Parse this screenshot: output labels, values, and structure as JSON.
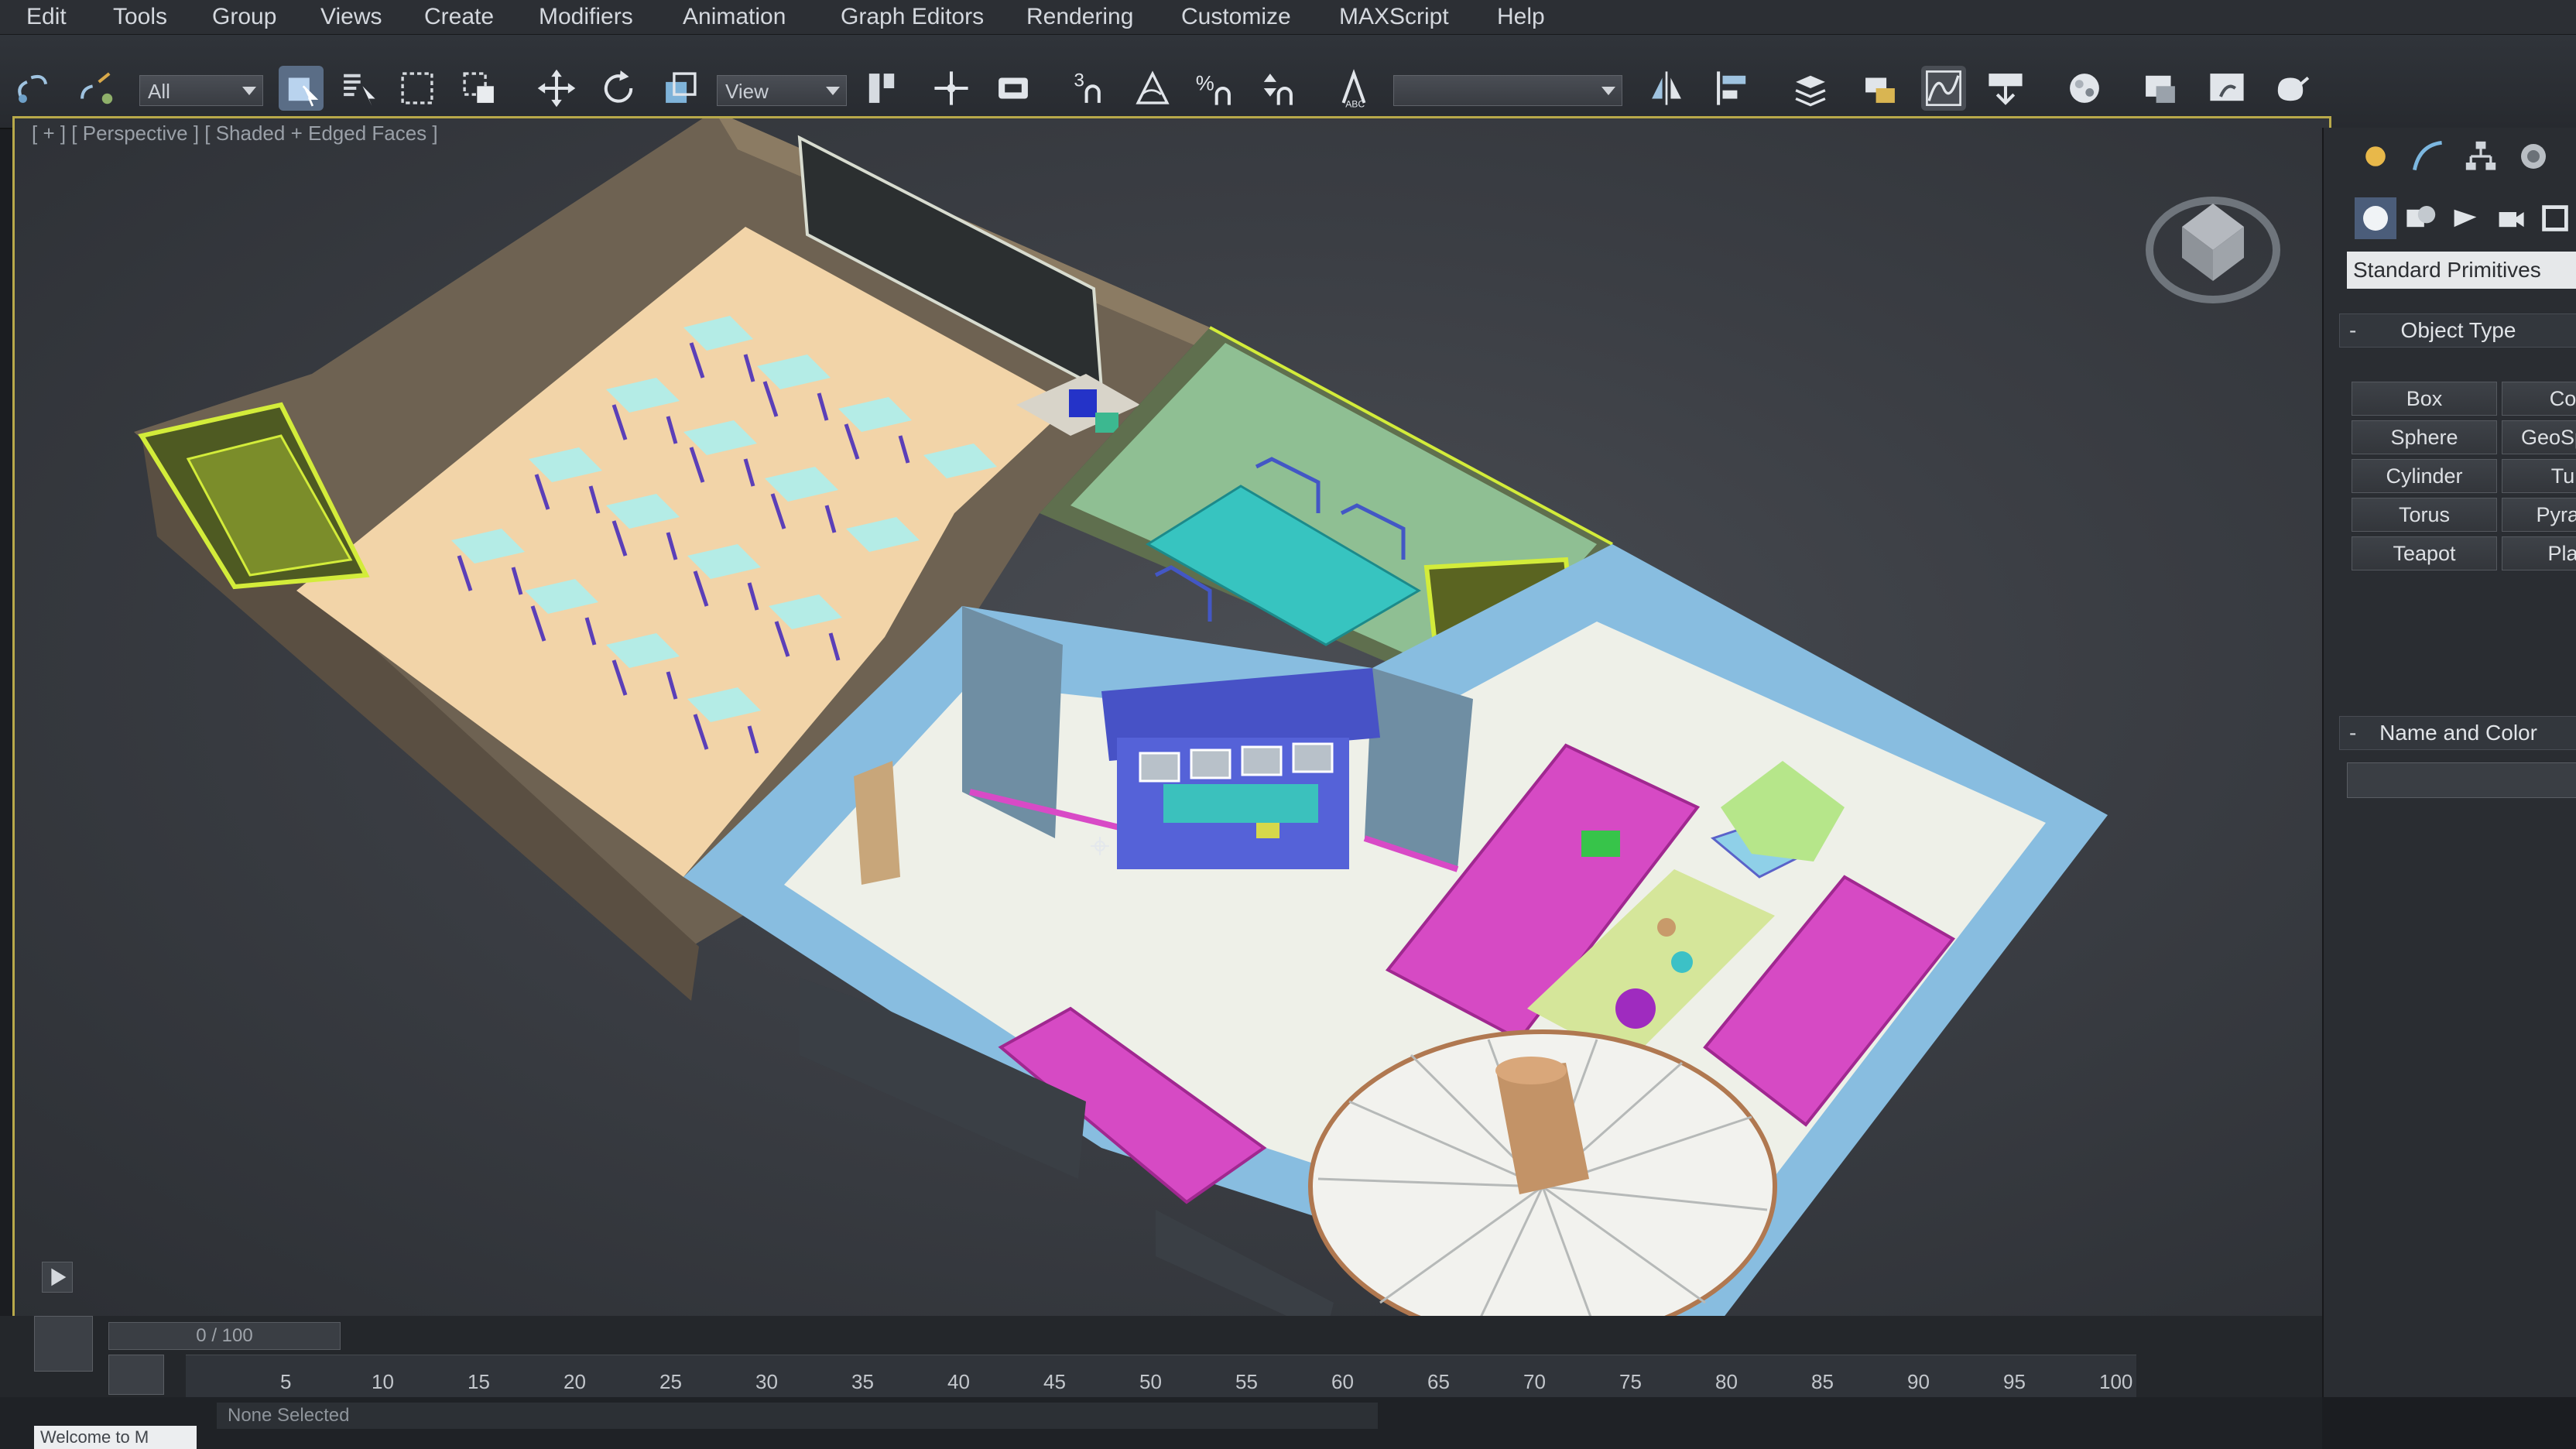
{
  "menu": {
    "items": [
      "Edit",
      "Tools",
      "Group",
      "Views",
      "Create",
      "Modifiers",
      "Animation",
      "Graph Editors",
      "Rendering",
      "Customize",
      "MAXScript",
      "Help"
    ]
  },
  "toolbar": {
    "selection_filter": "All",
    "reference_coord": "View",
    "named_selection_sets": "",
    "icons": [
      "select-and-link-icon",
      "unlink-icon",
      "select-object-icon",
      "select-by-name-icon",
      "rectangular-selection-icon",
      "window-crossing-icon",
      "select-and-move-icon",
      "select-and-rotate-icon",
      "select-and-scale-icon",
      "use-pivot-center-icon",
      "select-and-manipulate-icon",
      "keyboard-shortcut-override-icon",
      "snaps-toggle-icon",
      "angle-snap-icon",
      "percent-snap-icon",
      "spinner-snap-icon",
      "edit-named-selection-icon",
      "mirror-icon",
      "align-icon",
      "layer-manager-icon",
      "scene-explorer-icon",
      "curve-editor-icon",
      "schematic-view-icon",
      "material-editor-icon",
      "render-setup-icon",
      "rendered-frame-window-icon",
      "render-production-icon"
    ]
  },
  "viewport": {
    "label": "[ + ] [ Perspective ] [ Shaded + Edged Faces ]"
  },
  "command_panel": {
    "tabs": [
      "create-tab-icon",
      "modify-tab-icon",
      "hierarchy-tab-icon",
      "motion-tab-icon"
    ],
    "subtabs": [
      "geometry-icon",
      "shapes-icon",
      "lights-icon",
      "cameras-icon",
      "helpers-icon"
    ],
    "category": "Standard Primitives",
    "object_type_title": "Object Type",
    "primitives": [
      "Box",
      "Cone",
      "Sphere",
      "GeoSphere",
      "Cylinder",
      "Tube",
      "Torus",
      "Pyramid",
      "Teapot",
      "Plane"
    ],
    "name_and_color_title": "Name and Color",
    "name_value": ""
  },
  "timeline": {
    "slider_label": "0 / 100",
    "ticks": [
      "5",
      "10",
      "15",
      "20",
      "25",
      "30",
      "35",
      "40",
      "45",
      "50",
      "55",
      "60",
      "65",
      "70",
      "75",
      "80",
      "85",
      "90",
      "95",
      "100"
    ],
    "status": "None Selected",
    "listener": "Welcome to M"
  },
  "colors": {
    "viewport_border": "#b8a94a",
    "wall_yellow": "#c9dc3a",
    "floor_beige": "#f1d3a8",
    "wall_blue": "#8ec4e6",
    "sofa_magenta": "#d84ac6",
    "bar_blue": "#4a55c8",
    "chair_cyan": "#a5ece8"
  }
}
